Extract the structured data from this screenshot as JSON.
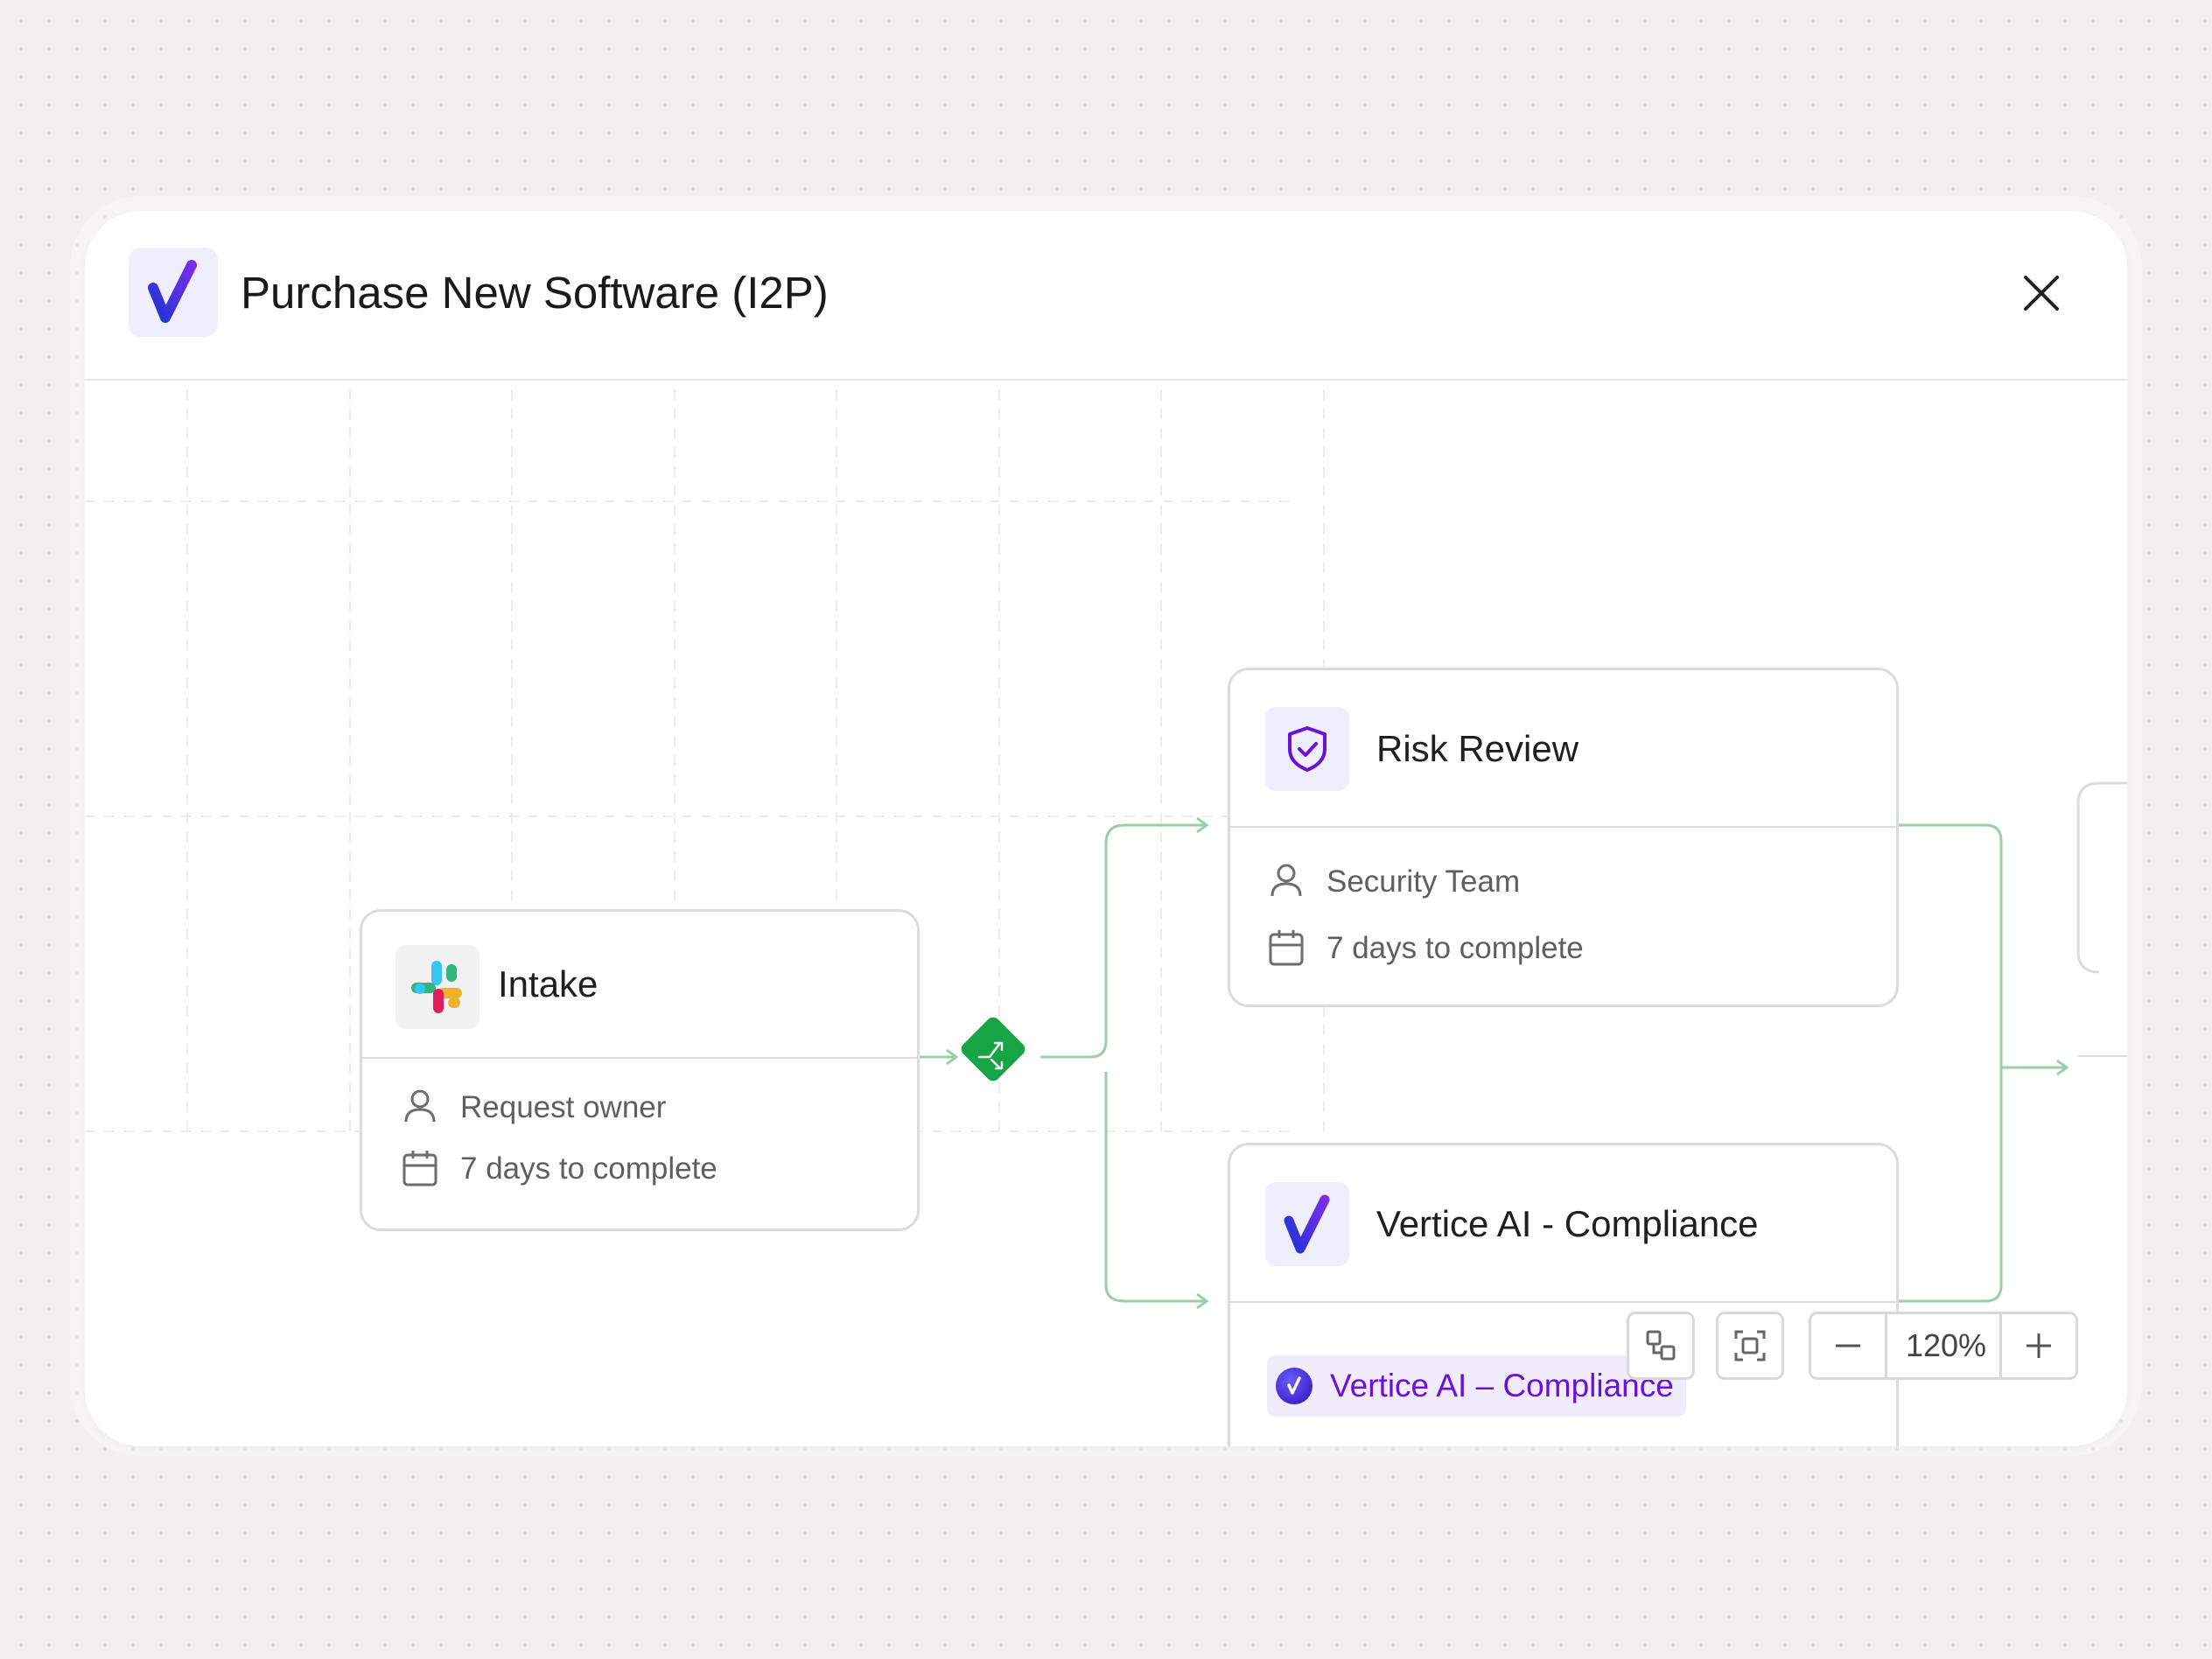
{
  "workflow": {
    "title": "Purchase New Software (I2P)",
    "logo_icon": "vertice-logo-icon",
    "close_icon": "close-icon"
  },
  "nodes": {
    "intake": {
      "title": "Intake",
      "icon": "slack-icon",
      "assignee": "Request owner",
      "duration": "7 days to complete"
    },
    "risk_review": {
      "title": "Risk Review",
      "icon": "shield-check-icon",
      "assignee": "Security Team",
      "duration": "7 days to complete"
    },
    "compliance": {
      "title": "Vertice AI - Compliance",
      "icon": "vertice-logo-icon",
      "tag_label": "Vertice AI – Compliance"
    }
  },
  "toolbar": {
    "zoom_level": "120%",
    "buttons": [
      "auto-layout-icon",
      "fit-view-icon",
      "zoom-out-icon",
      "zoom-in-icon"
    ]
  },
  "colors": {
    "accent_purple": "#6a12d8",
    "connector_green": "#9acfa7",
    "gateway_green": "#17a444",
    "logo_blue": "#2d3fe0"
  }
}
